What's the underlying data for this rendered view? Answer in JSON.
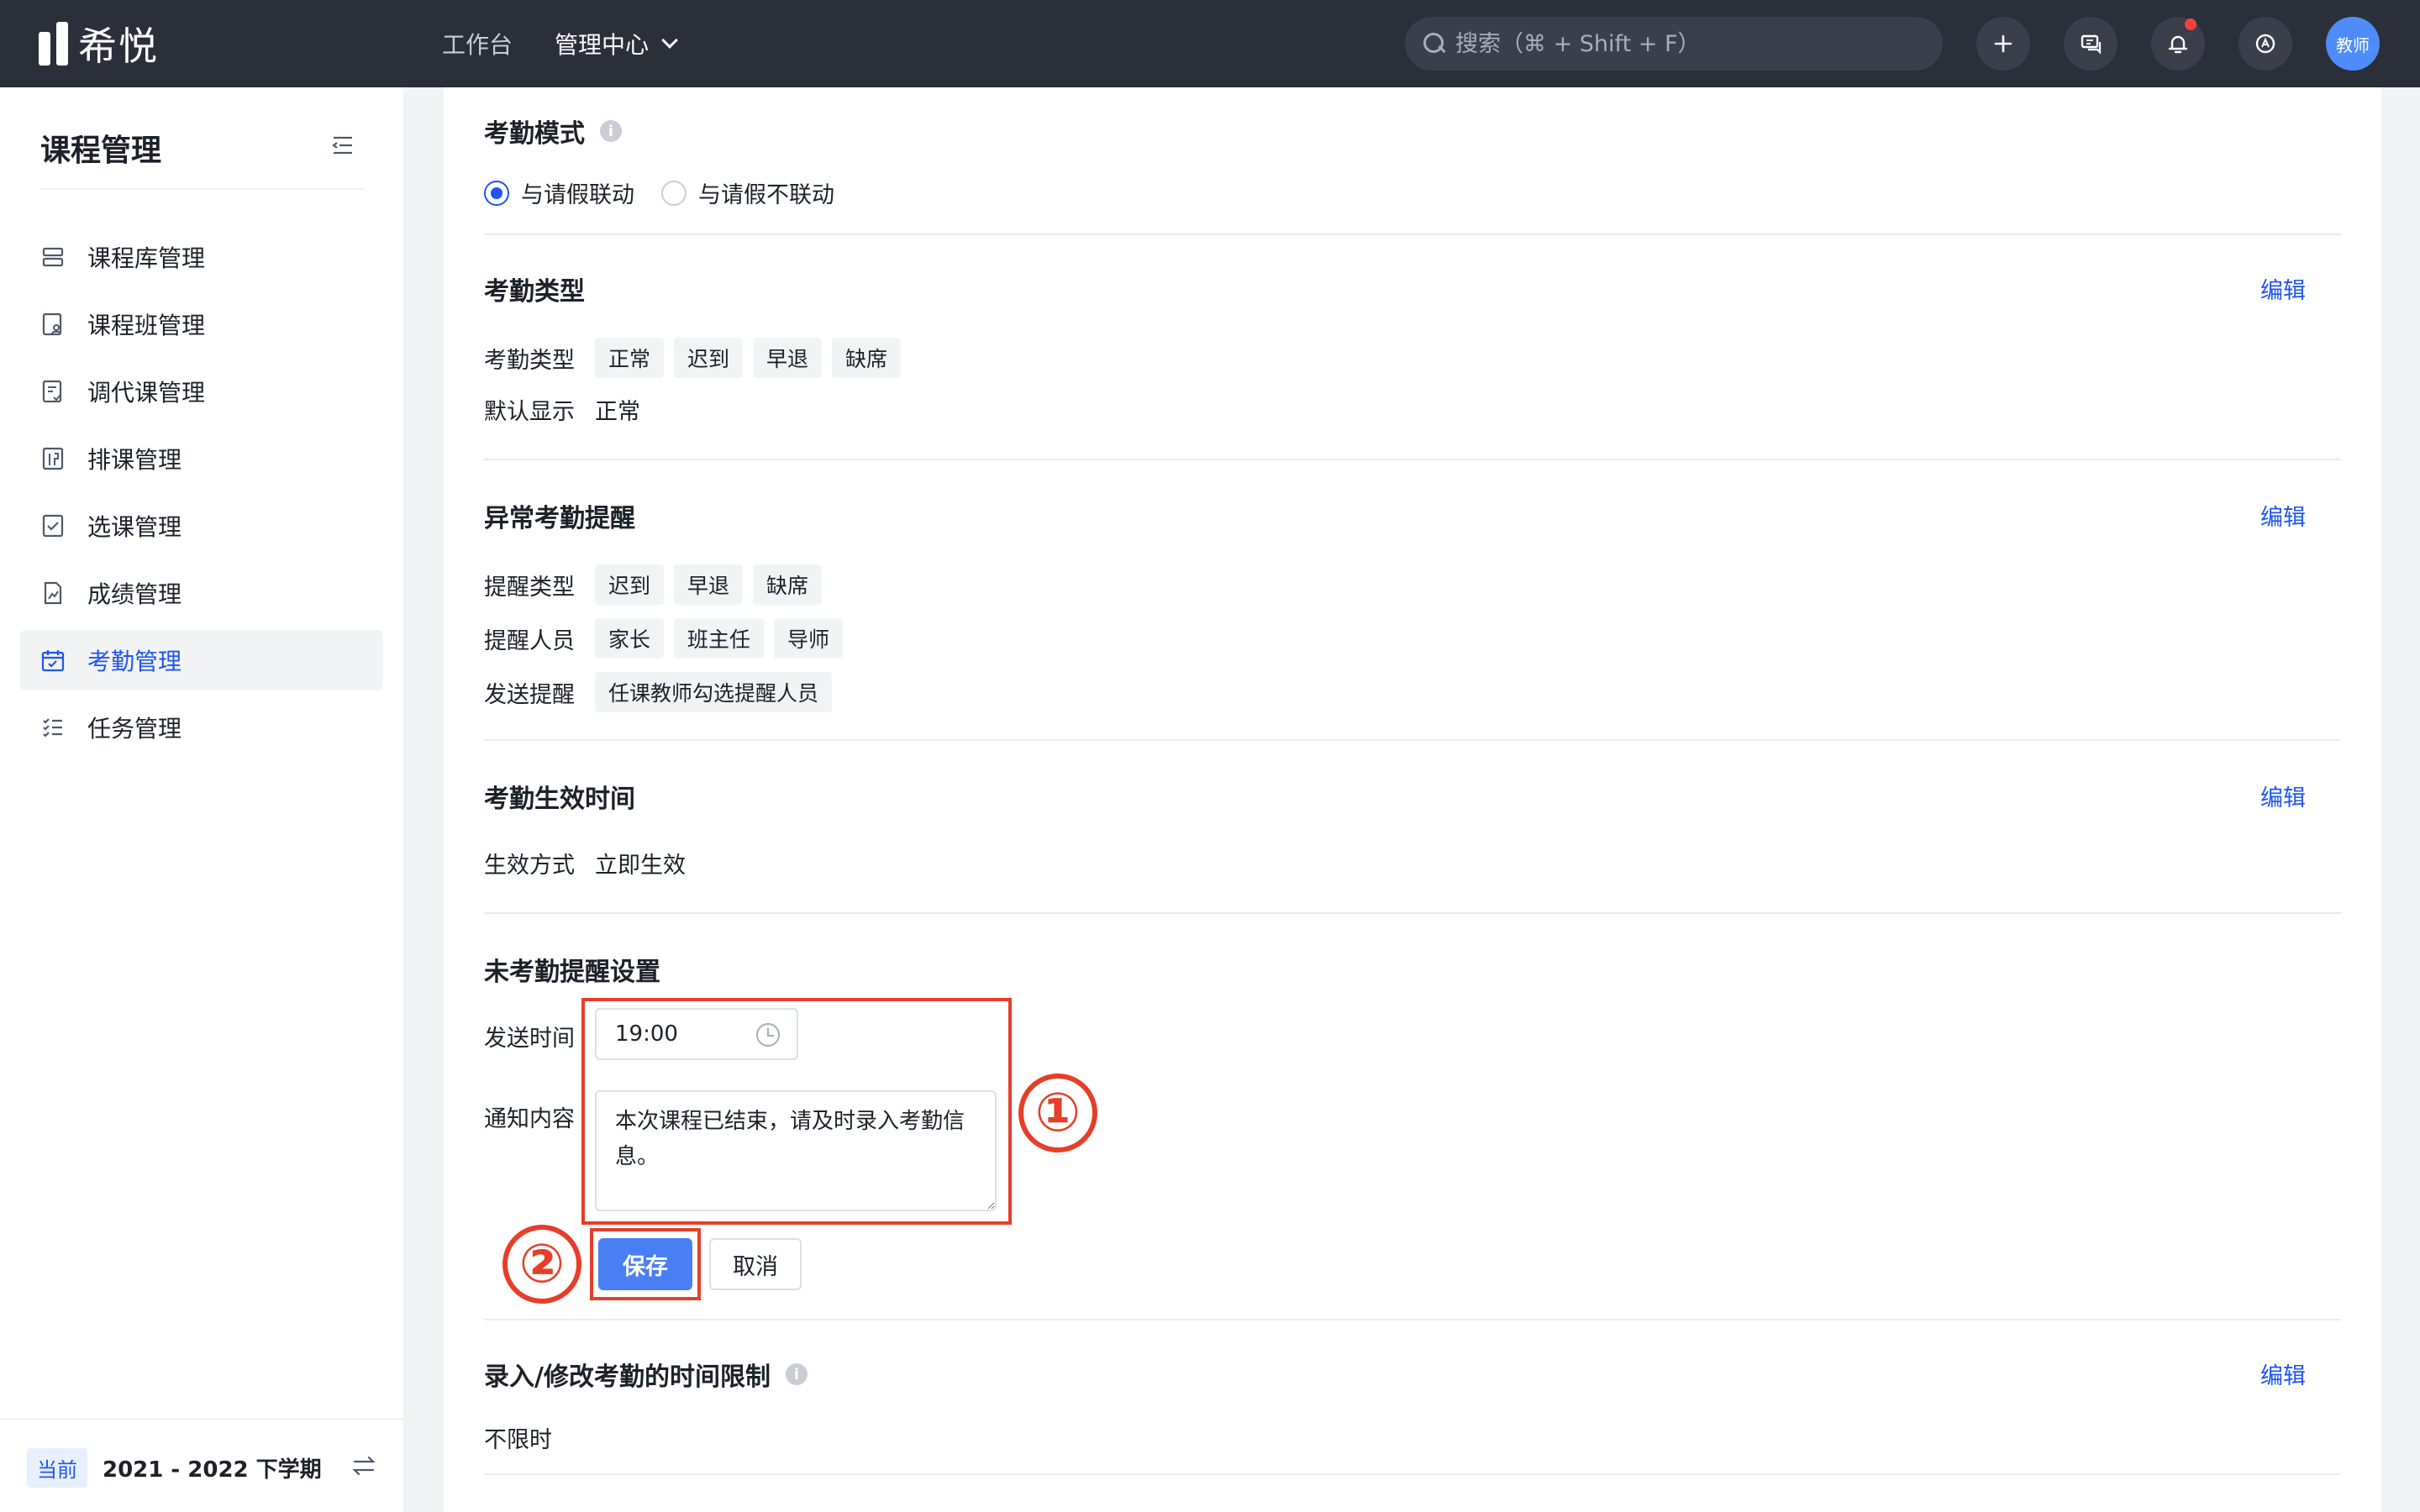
{
  "app": {
    "logo_text": "希悦"
  },
  "topnav": {
    "items": [
      "工作台",
      "管理中心"
    ]
  },
  "search": {
    "placeholder": "搜索（⌘ + Shift + F）"
  },
  "user": {
    "avatar_label": "教师"
  },
  "sidebar": {
    "title": "课程管理",
    "items": [
      {
        "label": "课程库管理",
        "icon": "database-icon"
      },
      {
        "label": "课程班管理",
        "icon": "class-icon"
      },
      {
        "label": "调代课管理",
        "icon": "substitute-icon"
      },
      {
        "label": "排课管理",
        "icon": "schedule-icon"
      },
      {
        "label": "选课管理",
        "icon": "checkbox-icon"
      },
      {
        "label": "成绩管理",
        "icon": "score-icon"
      },
      {
        "label": "考勤管理",
        "icon": "calendar-icon",
        "active": true
      },
      {
        "label": "任务管理",
        "icon": "task-list-icon"
      }
    ],
    "footer": {
      "tag": "当前",
      "term": "2021 - 2022 下学期"
    }
  },
  "sections": {
    "mode": {
      "title": "考勤模式",
      "options": [
        "与请假联动",
        "与请假不联动"
      ],
      "selected": "与请假联动"
    },
    "type": {
      "title": "考勤类型",
      "edit": "编辑",
      "type_label": "考勤类型",
      "type_tags": [
        "正常",
        "迟到",
        "早退",
        "缺席"
      ],
      "default_label": "默认显示",
      "default_value": "正常"
    },
    "abnormal": {
      "title": "异常考勤提醒",
      "edit": "编辑",
      "remind_type_label": "提醒类型",
      "remind_type_tags": [
        "迟到",
        "早退",
        "缺席"
      ],
      "remind_people_label": "提醒人员",
      "remind_people_tags": [
        "家长",
        "班主任",
        "导师"
      ],
      "send_label": "发送提醒",
      "send_tag": "任课教师勾选提醒人员"
    },
    "effective": {
      "title": "考勤生效时间",
      "edit": "编辑",
      "method_label": "生效方式",
      "method_value": "立即生效"
    },
    "reminder": {
      "title": "未考勤提醒设置",
      "time_label": "发送时间",
      "time_value": "19:00",
      "content_label": "通知内容",
      "content_value": "本次课程已结束，请及时录入考勤信息。",
      "save": "保存",
      "cancel": "取消"
    },
    "limit": {
      "title": "录入/修改考勤的时间限制",
      "edit": "编辑",
      "value": "不限时"
    }
  },
  "annotations": {
    "step1": "①",
    "step2": "②",
    "color": "#e63e29"
  },
  "colors": {
    "primary": "#1f54f0",
    "topbar": "#2b2f3a",
    "button": "#4a7ef5"
  }
}
